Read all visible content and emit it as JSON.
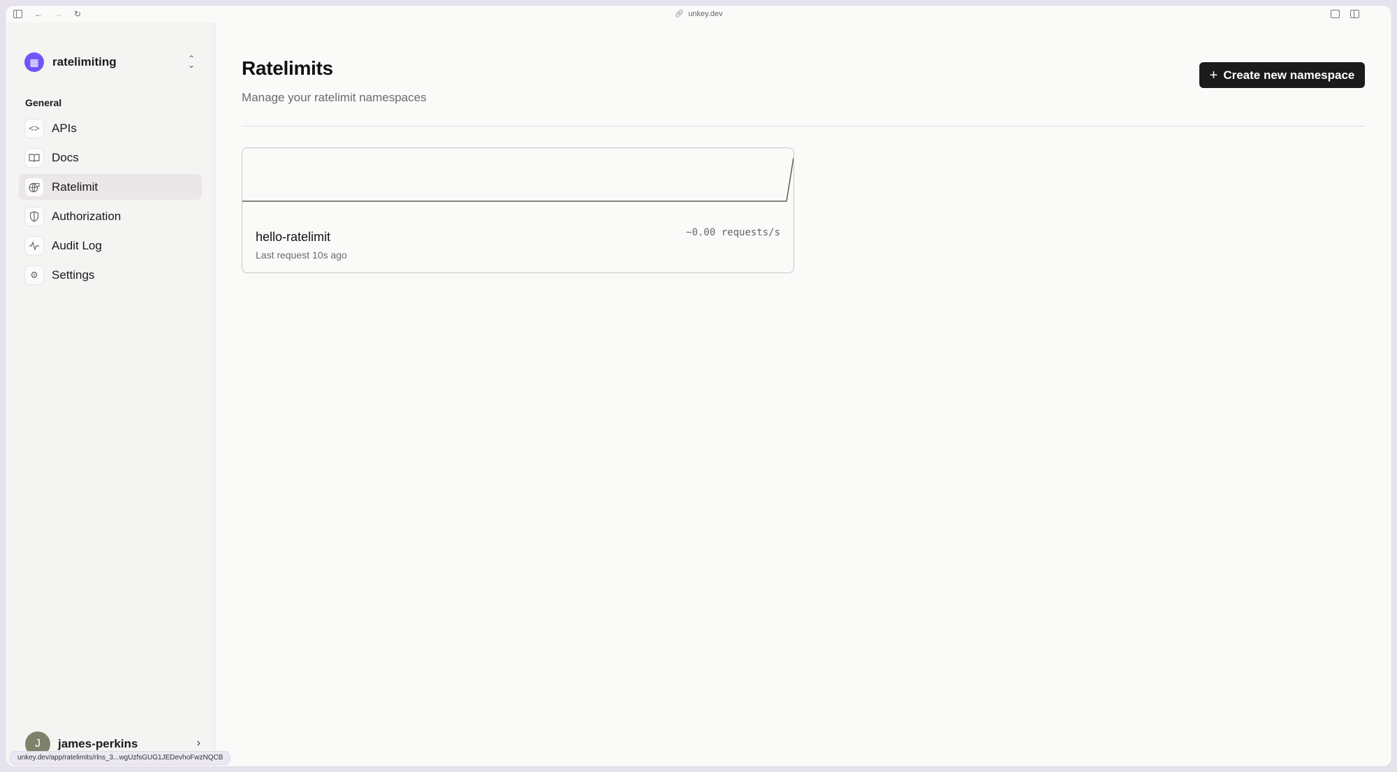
{
  "browser": {
    "url": "unkey.dev",
    "status_url": "unkey.dev/app/ratelimits/rlns_3...wgUzfsGUG1JEDevhoFwzNQCB"
  },
  "sidebar": {
    "workspace": {
      "name": "ratelimiting",
      "avatar_icon": "building-icon",
      "avatar_color": "#6e56f8"
    },
    "section_label": "General",
    "items": [
      {
        "label": "APIs",
        "icon": "code-icon",
        "active": false
      },
      {
        "label": "Docs",
        "icon": "book-icon",
        "active": false
      },
      {
        "label": "Ratelimit",
        "icon": "globe-lock-icon",
        "active": true
      },
      {
        "label": "Authorization",
        "icon": "shield-icon",
        "active": false
      },
      {
        "label": "Audit Log",
        "icon": "activity-icon",
        "active": false
      },
      {
        "label": "Settings",
        "icon": "gear-icon",
        "active": false
      }
    ],
    "user": {
      "name": "james-perkins",
      "initial": "J"
    }
  },
  "main": {
    "title": "Ratelimits",
    "subtitle": "Manage your ratelimit namespaces",
    "create_button": {
      "icon": "+",
      "label": "Create new namespace"
    },
    "namespaces": [
      {
        "name": "hello-ratelimit",
        "last_request": "Last request 10s ago",
        "rate": "~0.00 requests/s",
        "sparkline": [
          0,
          0,
          0,
          0,
          0,
          0,
          0,
          0,
          0,
          0,
          0,
          0,
          0,
          0,
          0,
          0,
          0,
          0,
          0,
          0,
          0,
          0,
          0,
          0,
          0,
          0,
          0,
          0,
          0,
          0,
          0,
          0,
          0,
          0,
          0,
          0,
          0,
          0,
          0,
          0,
          0,
          0,
          0,
          0,
          0,
          0,
          0,
          0,
          0,
          0,
          0,
          0,
          0,
          0,
          0,
          0,
          0,
          0,
          0,
          0,
          0,
          0,
          0,
          0,
          0,
          0,
          0,
          0,
          0,
          0,
          0,
          0,
          0,
          0,
          0,
          0,
          0,
          0,
          0,
          1
        ]
      }
    ]
  }
}
